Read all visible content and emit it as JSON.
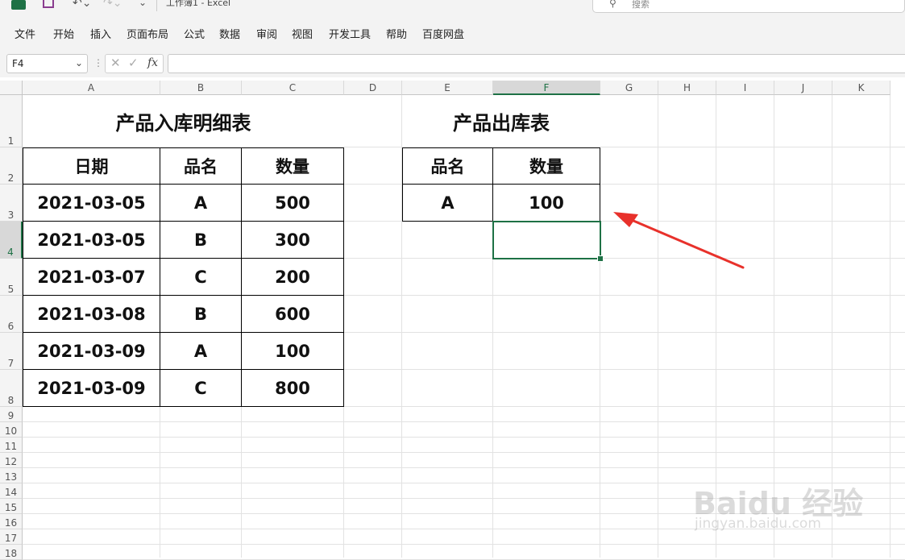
{
  "window": {
    "title": "工作簿1  -  Excel",
    "search_placeholder": "搜索"
  },
  "menu": [
    "文件",
    "开始",
    "插入",
    "页面布局",
    "公式",
    "数据",
    "审阅",
    "视图",
    "开发工具",
    "帮助",
    "百度网盘"
  ],
  "formula_bar": {
    "name_box": "F4",
    "fx_label": "fx",
    "formula": ""
  },
  "columns": [
    "A",
    "B",
    "C",
    "D",
    "E",
    "F",
    "G",
    "H",
    "I",
    "J",
    "K"
  ],
  "rows": [
    "1",
    "2",
    "3",
    "4",
    "5",
    "6",
    "7",
    "8",
    "9",
    "10",
    "11",
    "12",
    "13",
    "14",
    "15",
    "16",
    "17",
    "18"
  ],
  "selected_cell": "F4",
  "inbound_table": {
    "title": "产品入库明细表",
    "headers": [
      "日期",
      "品名",
      "数量"
    ],
    "rows": [
      [
        "2021-03-05",
        "A",
        "500"
      ],
      [
        "2021-03-05",
        "B",
        "300"
      ],
      [
        "2021-03-07",
        "C",
        "200"
      ],
      [
        "2021-03-08",
        "B",
        "600"
      ],
      [
        "2021-03-09",
        "A",
        "100"
      ],
      [
        "2021-03-09",
        "C",
        "800"
      ]
    ]
  },
  "outbound_table": {
    "title": "产品出库表",
    "headers": [
      "品名",
      "数量"
    ],
    "rows": [
      [
        "A",
        "100"
      ],
      [
        ""
      ]
    ]
  },
  "watermark": {
    "logo": "Baidu 经验",
    "url": "jingyan.baidu.com"
  },
  "colors": {
    "accent": "#1e7145",
    "arrow": "#e8312b"
  }
}
